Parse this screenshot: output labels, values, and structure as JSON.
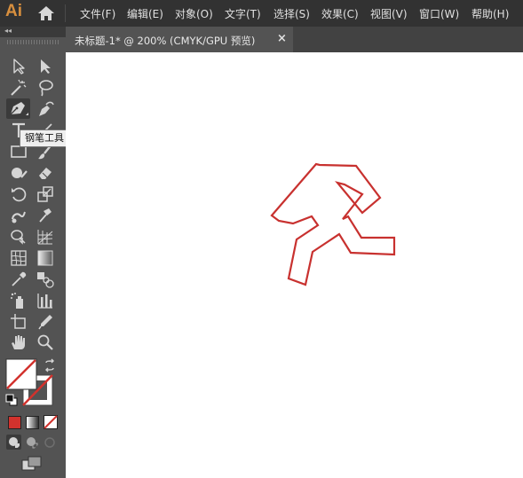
{
  "app": {
    "logo": "Ai"
  },
  "menu": [
    "文件(F)",
    "编辑(E)",
    "对象(O)",
    "文字(T)",
    "选择(S)",
    "效果(C)",
    "视图(V)",
    "窗口(W)",
    "帮助(H)"
  ],
  "document_tab": {
    "title": "未标题-1* @ 200% (CMYK/GPU 预览)",
    "close": "×"
  },
  "tooltip": "钢笔工具 (P)",
  "toolbar": {
    "collapse": "◂◂",
    "active_tool": "pen-tool"
  },
  "colors": {
    "fill": "none",
    "stroke": "none",
    "color_mode": "#d2322d",
    "path_stroke": "#c8312f"
  }
}
